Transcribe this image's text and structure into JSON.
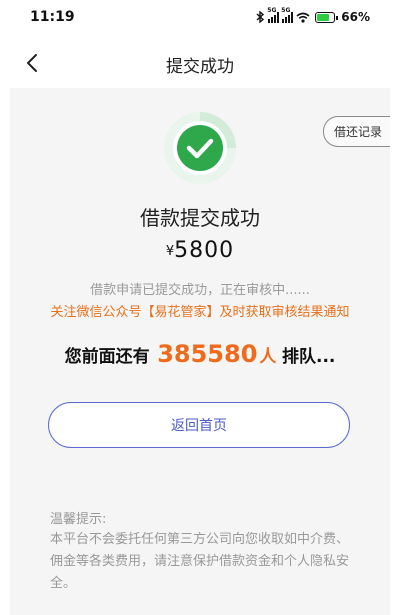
{
  "status_bar": {
    "time": "11:19",
    "network_1": "5G",
    "network_2": "5G",
    "battery_percent": "66%",
    "icons": [
      "bluetooth-icon",
      "signal-icon",
      "signal-icon",
      "wifi-icon",
      "battery-icon"
    ]
  },
  "nav": {
    "title": "提交成功",
    "back_icon": "chevron-left-icon"
  },
  "record_button": "借还记录",
  "success": {
    "icon": "check-circle-icon",
    "title": "借款提交成功",
    "currency": "¥",
    "amount": "5800",
    "review_text": "借款申请已提交成功，正在审核中......",
    "follow_text": "关注微信公众号【易花管家】及时获取审核结果通知"
  },
  "queue": {
    "prefix": "您前面还有",
    "count": "385580",
    "unit": "人",
    "suffix": "排队..."
  },
  "home_button": "返回首页",
  "tip": {
    "title": "温馨提示:",
    "body": "本平台不会委托任何第三方公司向您收取如中介费、佣金等各类费用，请注意保护借款资金和个人隐私安全。"
  },
  "colors": {
    "accent_orange": "#f06a1c",
    "success_green": "#2ea84a",
    "button_blue": "#4a5cc8"
  }
}
